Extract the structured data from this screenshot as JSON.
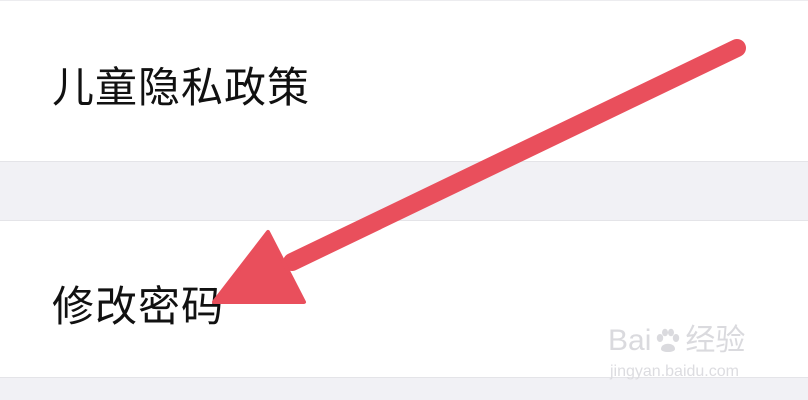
{
  "settings": {
    "items": [
      {
        "label": "儿童隐私政策"
      },
      {
        "label": "修改密码"
      }
    ]
  },
  "annotation": {
    "arrow_color": "#e94f5c"
  },
  "watermark": {
    "brand_left": "Bai",
    "brand_right": "经验",
    "paw_icon": "baidu-paw-icon",
    "url": "jingyan.baidu.com"
  },
  "colors": {
    "background": "#f1f1f5",
    "cell": "#ffffff",
    "text": "#111111"
  }
}
